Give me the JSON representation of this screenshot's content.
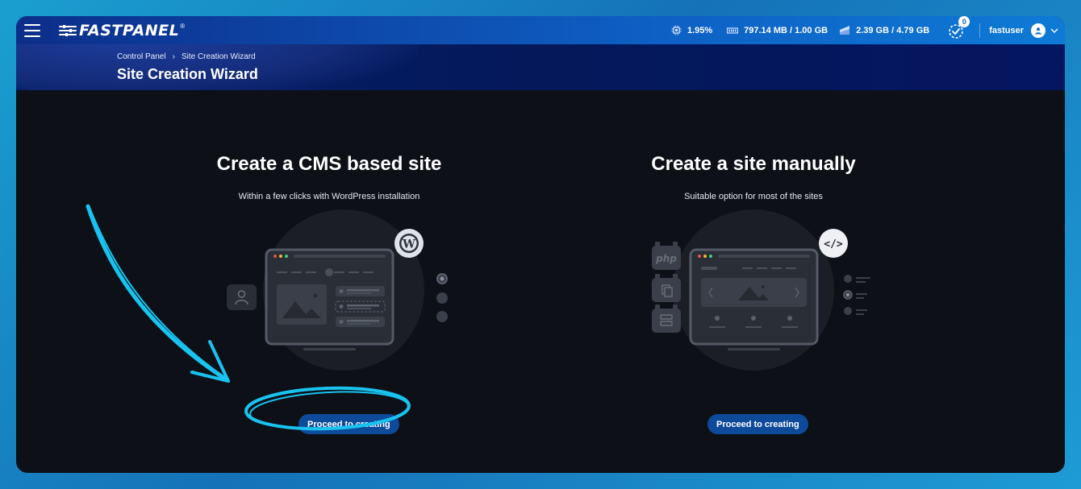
{
  "app": {
    "logo": "FASTPANEL",
    "registered": "®"
  },
  "stats": {
    "cpu": "1.95%",
    "memory": "797.14 MB / 1.00 GB",
    "disk": "2.39 GB / 4.79 GB",
    "tasks_count": "0"
  },
  "user": {
    "name": "fastuser"
  },
  "breadcrumb": {
    "root": "Control Panel",
    "separator": "›",
    "current": "Site Creation Wizard"
  },
  "page": {
    "title": "Site Creation Wizard"
  },
  "cards": [
    {
      "title": "Create a CMS based site",
      "subtitle": "Within a few clicks with WordPress installation",
      "button": "Proceed to creating"
    },
    {
      "title": "Create a site manually",
      "subtitle": "Suitable option for most of the sites",
      "button": "Proceed to creating",
      "php_label": "php"
    }
  ],
  "colors": {
    "accent": "#0e4a9a",
    "annotation": "#19c3f0",
    "background": "#0d1016",
    "topbar": "#0e5fc4"
  }
}
